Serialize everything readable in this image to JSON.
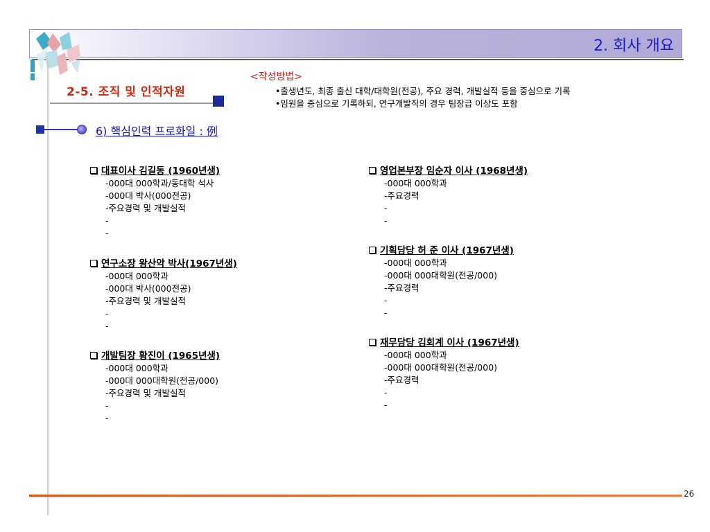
{
  "header": {
    "title": "2. 회사 개요"
  },
  "section": {
    "title": "2-5. 조직 및 인적자원"
  },
  "method": {
    "heading": "<작성방법>",
    "lines": [
      "•출생년도, 최종 출신 대학/대학원(전공), 주요 경력, 개발실적 등을 중심으로 기록",
      "•임원을 중심으로 기록하되, 연구개발직의 경우 팀장급 이상도 포함"
    ]
  },
  "subsection": {
    "title": "6) 핵심인력 프로화일 : 例"
  },
  "people": [
    {
      "name": "대표이사 김길동 (1960년생)",
      "lines": [
        "-000대 000학과/동대학 석사",
        "-000대 박사(000전공)",
        "-주요경력 및 개발실적",
        "-",
        "-"
      ]
    },
    {
      "name": "연구소장 왕산악 박사(1967년생)",
      "lines": [
        "-000대 000학과",
        "-000대 박사(000전공)",
        "-주요경력 및 개발실적",
        "-",
        "-"
      ]
    },
    {
      "name": "개발팀장 황진이 (1965년생)",
      "lines": [
        "-000대 000학과",
        "-000대 000대학원(전공/000)",
        "-주요경력 및 개발실적",
        "-",
        "-"
      ]
    },
    {
      "name": "영업본부장 임순자 이사 (1968년생)",
      "lines": [
        "-000대 000학과",
        "-주요경력",
        "-",
        "-"
      ]
    },
    {
      "name": "기획담당 허 준 이사 (1967년생)",
      "lines": [
        "-000대 000학과",
        "-000대 000대학원(전공/000)",
        "-주요경력",
        "-",
        "-"
      ]
    },
    {
      "name": "재무담당 김회계 이사 (1967년생)",
      "lines": [
        "-000대 000학과",
        "-000대 000대학원(전공/000)",
        "-주요경력",
        "-",
        "-"
      ]
    }
  ],
  "footer": {
    "page_number": "26"
  },
  "colors": {
    "title_blue": "#1a1acc",
    "section_red": "#cc2a10",
    "accent_navy": "#1d2a9a",
    "footer_orange": "#e8501a"
  }
}
